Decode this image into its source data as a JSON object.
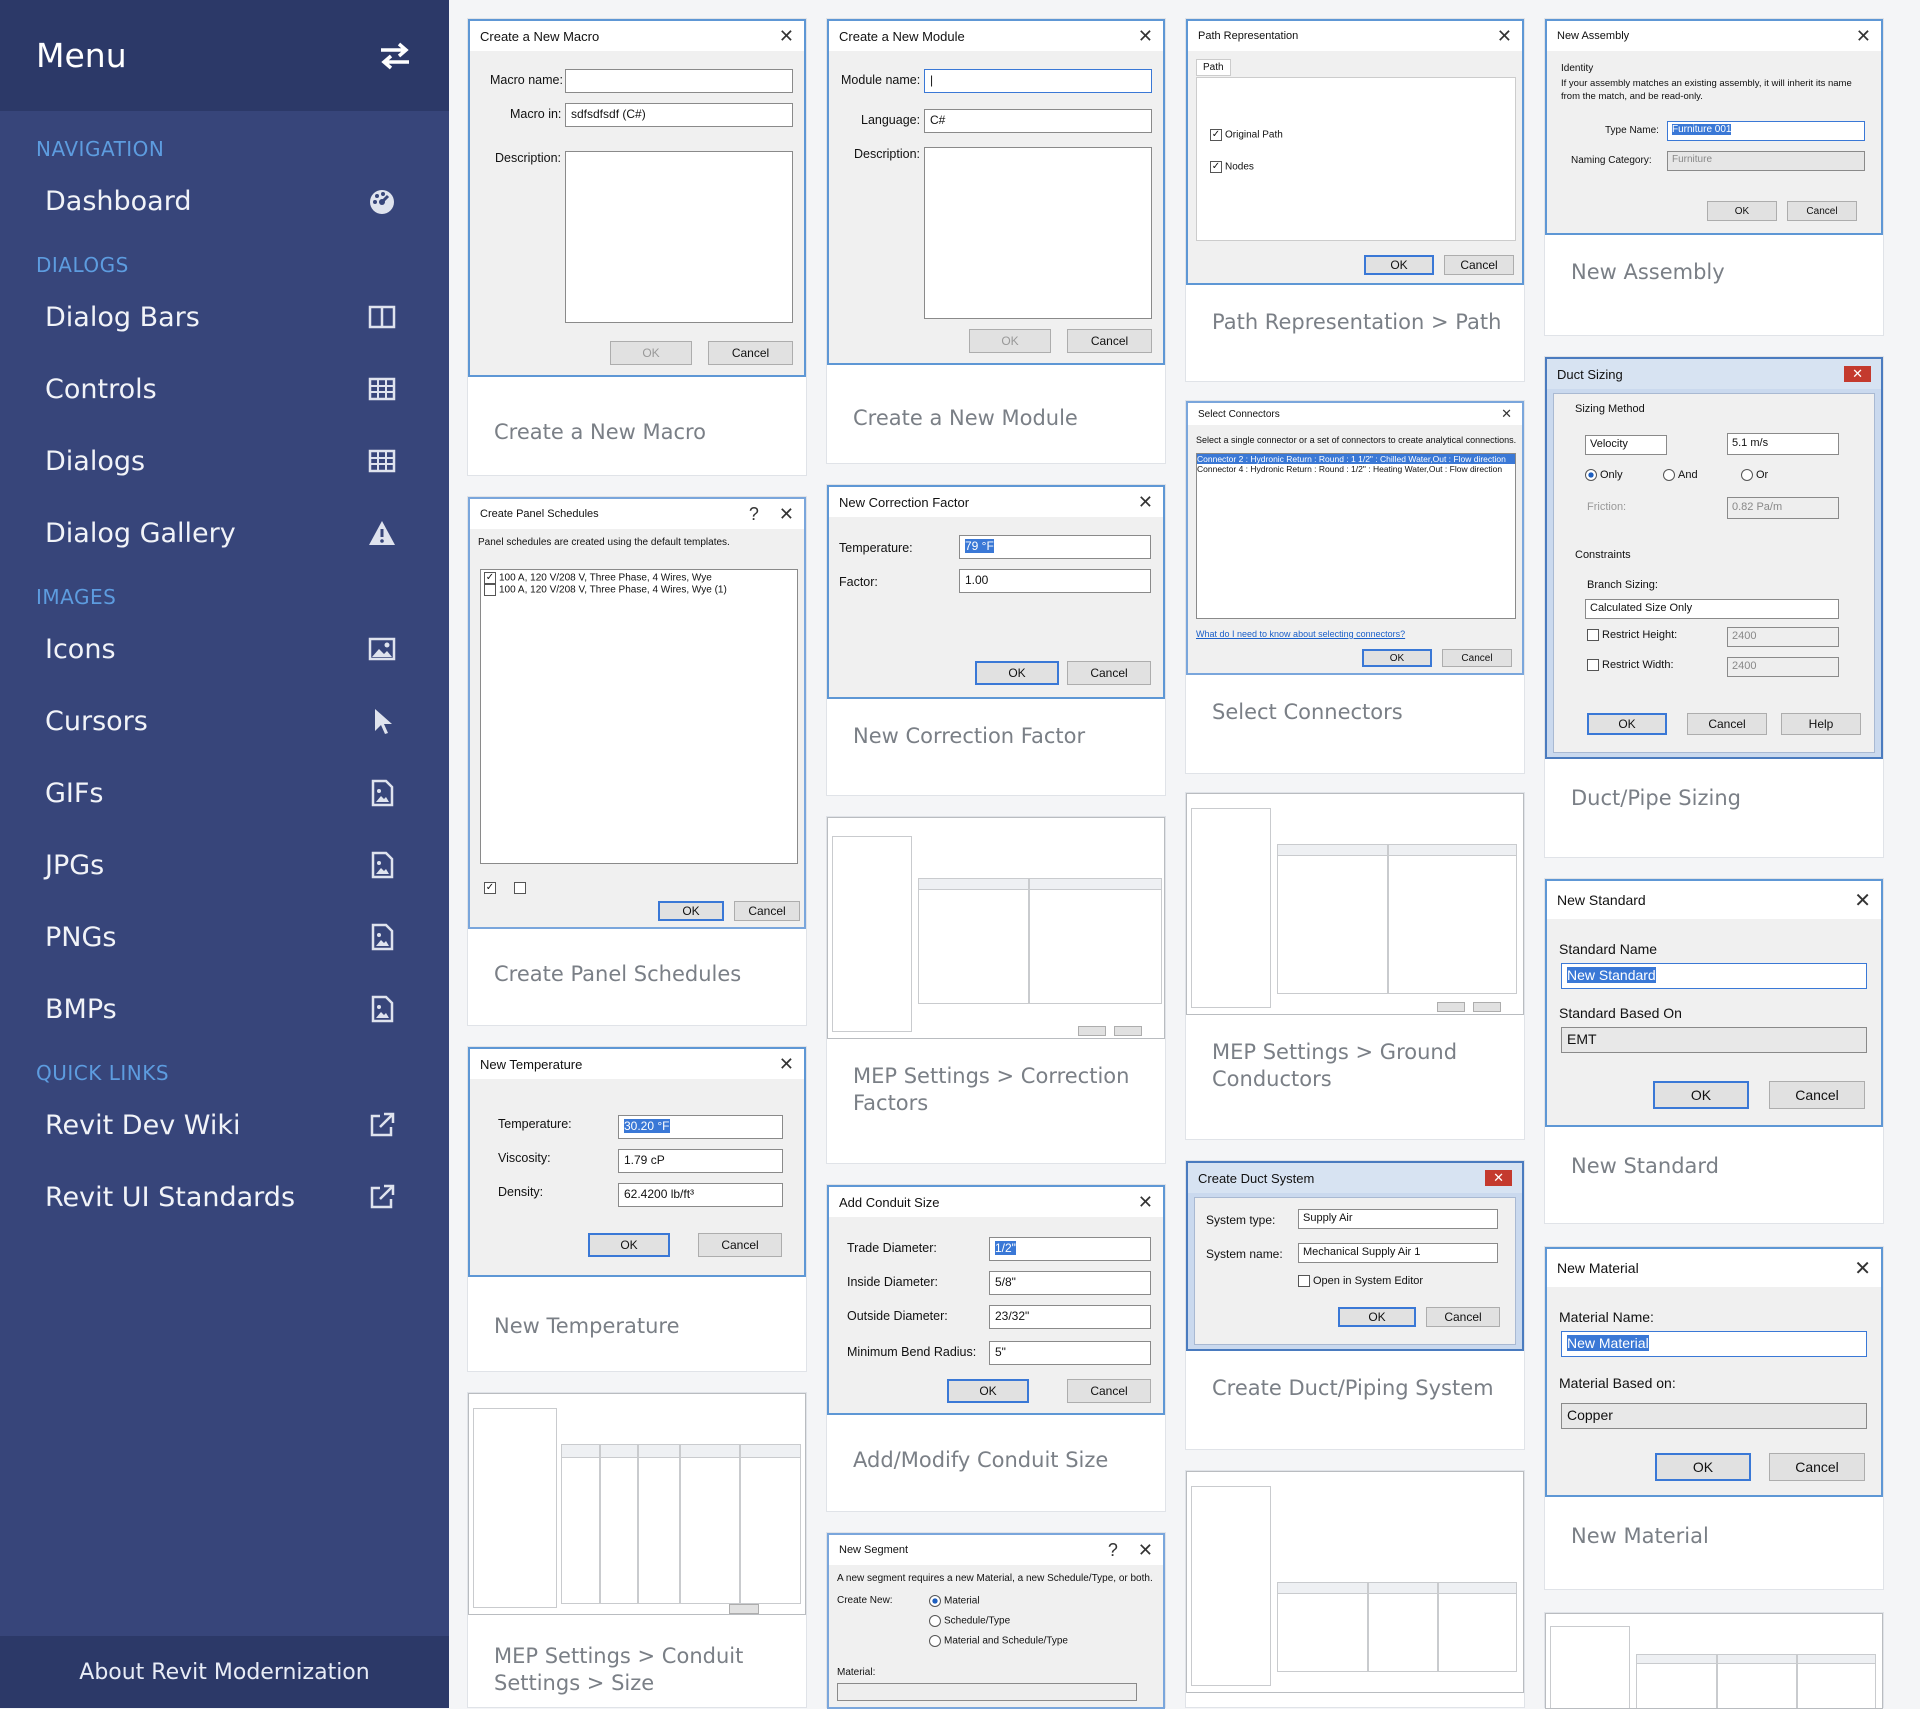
{
  "sidebar": {
    "title": "Menu",
    "sections": {
      "navigation": "NAVIGATION",
      "dialogs": "DIALOGS",
      "images": "IMAGES",
      "quick_links": "QUICK LINKS"
    },
    "items": {
      "dashboard": "Dashboard",
      "dialog_bars": "Dialog Bars",
      "controls": "Controls",
      "dialogs": "Dialogs",
      "dialog_gallery": "Dialog Gallery",
      "icons": "Icons",
      "cursors": "Cursors",
      "gifs": "GIFs",
      "jpgs": "JPGs",
      "pngs": "PNGs",
      "bmps": "BMPs",
      "revit_dev_wiki": "Revit Dev Wiki",
      "revit_ui_standards": "Revit UI Standards"
    },
    "about": "About Revit Modernization"
  },
  "cards": {
    "macro": {
      "caption": "Create a New Macro",
      "title": "Create a New Macro",
      "name_label": "Macro name:",
      "in_label": "Macro in:",
      "in_value": "sdfsdfsdf (C#)",
      "desc_label": "Description:",
      "ok": "OK",
      "cancel": "Cancel"
    },
    "module": {
      "caption": "Create a New Module",
      "title": "Create a New Module",
      "name_label": "Module name:",
      "lang_label": "Language:",
      "lang_value": "C#",
      "desc_label": "Description:",
      "ok": "OK",
      "cancel": "Cancel"
    },
    "path": {
      "caption": "Path Representation > Path",
      "title": "Path Representation",
      "tab": "Path",
      "original": "Original Path",
      "nodes": "Nodes",
      "ok": "OK",
      "cancel": "Cancel"
    },
    "assembly": {
      "caption": "New Assembly",
      "title": "New Assembly",
      "identity": "Identity",
      "note": "If your assembly matches an existing assembly, it will inherit its name from the match, and be read-only.",
      "type_label": "Type Name:",
      "type_value": "Furniture 001",
      "cat_label": "Naming Category:",
      "cat_value": "Furniture",
      "ok": "OK",
      "cancel": "Cancel"
    },
    "connectors": {
      "caption": "Select Connectors",
      "title": "Select Connectors",
      "note": "Select a single connector or a set of connectors to create analytical connections.",
      "row1": "Connector 2 : Hydronic Return : Round : 1 1/2\" : Chilled Water,Out : Flow direction",
      "row2": "Connector 4 : Hydronic Return : Round : 1/2\" : Heating Water,Out : Flow direction",
      "link": "What do I need to know about selecting connectors?",
      "ok": "OK",
      "cancel": "Cancel"
    },
    "duct_sizing": {
      "caption": "Duct/Pipe Sizing",
      "title": "Duct Sizing",
      "method": "Sizing Method",
      "velocity": "Velocity",
      "vel_value": "5.1 m/s",
      "only": "Only",
      "and": "And",
      "or": "Or",
      "friction": "Friction:",
      "fric_value": "0.82 Pa/m",
      "constraints": "Constraints",
      "branch": "Branch Sizing:",
      "branch_value": "Calculated Size Only",
      "rh": "Restrict Height:",
      "rh_value": "2400",
      "rw": "Restrict Width:",
      "rw_value": "2400",
      "ok": "OK",
      "cancel": "Cancel",
      "help": "Help"
    },
    "panel": {
      "caption": "Create Panel Schedules",
      "title": "Create Panel Schedules",
      "note": "Panel schedules are created using the default templates.",
      "row1": "100 A, 120 V/208 V, Three Phase, 4 Wires, Wye",
      "row2": "100 A, 120 V/208 V, Three Phase, 4 Wires, Wye (1)",
      "ok": "OK",
      "cancel": "Cancel"
    },
    "correction": {
      "caption": "New Correction Factor",
      "title": "New Correction Factor",
      "temp_label": "Temperature:",
      "temp_value": "79 °F",
      "factor_label": "Factor:",
      "factor_value": "1.00",
      "ok": "OK",
      "cancel": "Cancel"
    },
    "mep_corr": {
      "caption": "MEP Settings > Correction Factors"
    },
    "mep_ground": {
      "caption": "MEP Settings > Ground Conductors"
    },
    "standard": {
      "caption": "New Standard",
      "title": "New Standard",
      "name_label": "Standard Name",
      "name_value": "New Standard",
      "based_label": "Standard Based On",
      "based_value": "EMT",
      "ok": "OK",
      "cancel": "Cancel"
    },
    "temperature": {
      "caption": "New Temperature",
      "title": "New Temperature",
      "temp_label": "Temperature:",
      "temp_value": "30.20 °F",
      "visc_label": "Viscosity:",
      "visc_value": "1.79 cP",
      "dens_label": "Density:",
      "dens_value": "62.4200 lb/ft³",
      "ok": "OK",
      "cancel": "Cancel"
    },
    "conduit": {
      "caption": "Add/Modify Conduit Size",
      "title": "Add Conduit Size",
      "trade": "Trade Diameter:",
      "trade_value": "1/2\"",
      "inside": "Inside Diameter:",
      "inside_value": "5/8\"",
      "outside": "Outside Diameter:",
      "outside_value": "23/32\"",
      "bend": "Minimum Bend Radius:",
      "bend_value": "5\"",
      "ok": "OK",
      "cancel": "Cancel"
    },
    "duct_system": {
      "caption": "Create Duct/Piping System",
      "title": "Create Duct System",
      "type_label": "System type:",
      "type_value": "Supply Air",
      "name_label": "System name:",
      "name_value": "Mechanical Supply Air 1",
      "open": "Open in System Editor",
      "ok": "OK",
      "cancel": "Cancel"
    },
    "material": {
      "caption": "New Material",
      "title": "New Material",
      "name_label": "Material Name:",
      "name_value": "New Material",
      "based_label": "Material Based on:",
      "based_value": "Copper",
      "ok": "OK",
      "cancel": "Cancel"
    },
    "mep_conduit": {
      "caption": "MEP Settings > Conduit Settings > Size"
    },
    "segment": {
      "title": "New Segment",
      "note": "A new segment requires a new Material, a new Schedule/Type, or both.",
      "create": "Create New:",
      "material": "Material",
      "schedule": "Schedule/Type",
      "both": "Material and Schedule/Type",
      "mat_label": "Material:"
    }
  }
}
